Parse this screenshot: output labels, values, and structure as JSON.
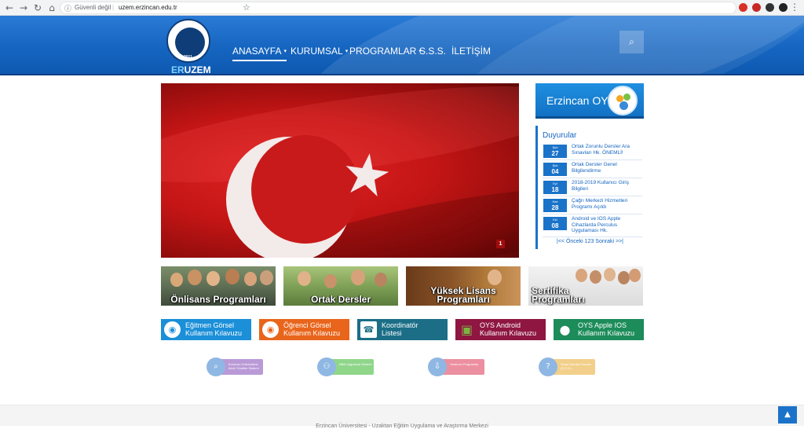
{
  "browser": {
    "back_icon": "←",
    "forward_icon": "→",
    "reload_icon": "↻",
    "home_icon": "⌂",
    "info_icon": "ⓘ",
    "security_label": "Güvenli değil",
    "separator": "|",
    "url": "uzem.erzincan.edu.tr",
    "star_icon": "☆",
    "menu_icon": "⋮",
    "extension_colors": [
      "#d93025",
      "#c62828",
      "#333333",
      "#222222",
      "#5f6368"
    ]
  },
  "header": {
    "logo_year": "2011",
    "logo_er": "ER",
    "logo_uzem": "UZEM",
    "nav": [
      {
        "label": "ANASAYFA",
        "caret": "▾"
      },
      {
        "label": "KURUMSAL",
        "caret": "▾"
      },
      {
        "label": "PROGRAMLAR",
        "caret": "▾"
      },
      {
        "label": "S.S.S.",
        "caret": ""
      },
      {
        "label": "İLETİŞİM",
        "caret": ""
      }
    ],
    "search_icon": "⌕"
  },
  "slider": {
    "slide_number": "1"
  },
  "oys": {
    "label": "Erzincan OYS"
  },
  "announcements": {
    "title": "Duyurular",
    "items": [
      {
        "month": "Şub",
        "day": "27",
        "text": "Ortak Zorunlu Dersler Ara Sınavları Hk. ÖNEMLİ!"
      },
      {
        "month": "Şub",
        "day": "04",
        "text": "Ortak Dersler Genel Bilgilendirme"
      },
      {
        "month": "Eyl",
        "day": "18",
        "text": "2018-2019 Kullanıcı Giriş Bilgileri"
      },
      {
        "month": "Haz",
        "day": "28",
        "text": "Çağrı Merkezi Hizmetleri Programı Açıldı"
      },
      {
        "month": "Eki",
        "day": "08",
        "text": "Android ve IOS Apple Cihazlarda Perculus Uygulaması Hk."
      }
    ],
    "pager": "|<< Önceki 123 Sonraki >>|"
  },
  "programs": [
    {
      "line1": "Önlisans Programları",
      "line2": ""
    },
    {
      "line1": "Ortak Dersler",
      "line2": ""
    },
    {
      "line1": "Yüksek Lisans",
      "line2": "Programları"
    },
    {
      "line1": "Sertifika",
      "line2": "Programları"
    }
  ],
  "guides": [
    {
      "line1": "Eğitmen Görsel",
      "line2": "Kullanım Kılavuzu",
      "icon": "◉",
      "color": "#1b8fd8"
    },
    {
      "line1": "Öğrenci Görsel",
      "line2": "Kullanım Kılavuzu",
      "icon": "◉",
      "color": "#e8651b"
    },
    {
      "line1": "Koordinatör",
      "line2": "Listesi",
      "icon": "☎",
      "color": "#1b6e86"
    },
    {
      "line1": "OYS Android",
      "line2": "Kullanım Kılavuzu",
      "icon": "▣",
      "color": "#8e1640"
    },
    {
      "line1": "OYS Apple IOS",
      "line2": "Kullanım Kılavuzu",
      "icon": "●",
      "color": "#1c8c5a"
    }
  ],
  "pills": [
    {
      "text": "Erzincan Üniversitesi Akıllı Yönetim Sistemi",
      "icon": "⌕",
      "color": "#b99ad6",
      "circle": "#8fb7e3"
    },
    {
      "text": "BBB Uygulama Sistemi",
      "icon": "⚇",
      "color": "#8fd68a",
      "circle": "#8fb7e3"
    },
    {
      "text": "Yardımcı Programlar",
      "icon": "⇩",
      "color": "#ec8fa0",
      "circle": "#8fb7e3"
    },
    {
      "text": "Sıkça Sorulan Sorular (S.S.S.)",
      "icon": "?",
      "color": "#f2cf8a",
      "circle": "#8fb7e3"
    }
  ],
  "footer": {
    "text": "Erzincan Üniversitesi - Uzaktan Eğitim Uygulama ve Araştırma Merkezi",
    "to_top_icon": "▲"
  }
}
